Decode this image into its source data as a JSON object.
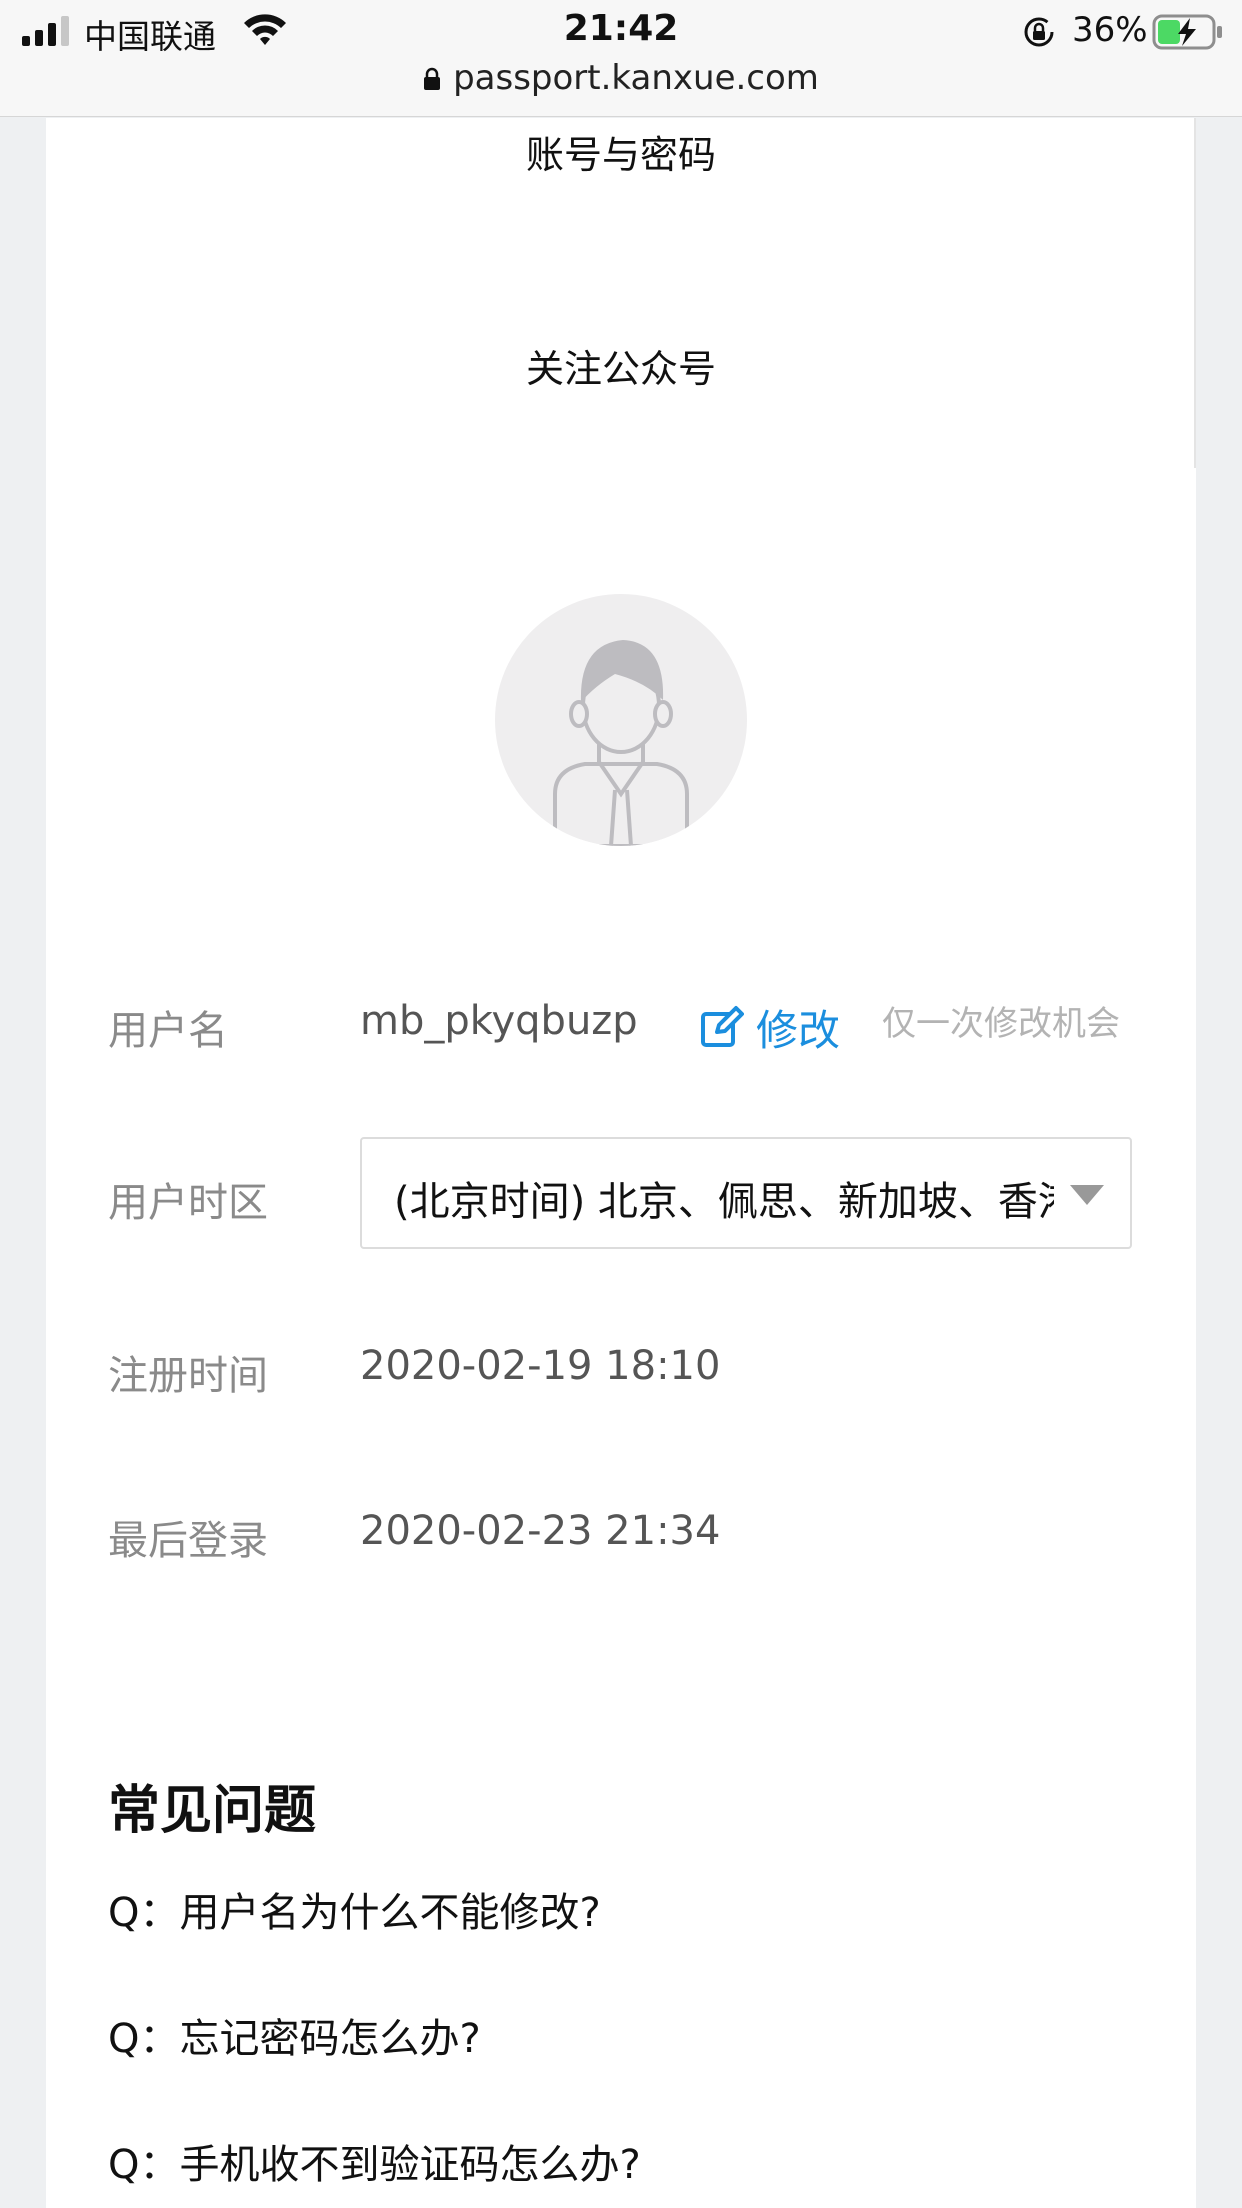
{
  "status_bar": {
    "carrier": "中国联通",
    "time": "21:42",
    "battery": "36%",
    "url": "passport.kanxue.com"
  },
  "menu": {
    "account_password": "账号与密码",
    "follow_wechat": "关注公众号"
  },
  "profile": {
    "username_label": "用户名",
    "username_value": "mb_pkyqbuzp",
    "edit_label": "修改",
    "edit_note": "仅一次修改机会",
    "timezone_label": "用户时区",
    "timezone_value": "(北京时间) 北京、佩思、新加坡、香港",
    "register_label": "注册时间",
    "register_value": "2020-02-19 18:10",
    "last_login_label": "最后登录",
    "last_login_value": "2020-02-23 21:34"
  },
  "faq": {
    "title": "常见问题",
    "questions": [
      "Q：用户名为什么不能修改?",
      "Q：忘记密码怎么办?",
      "Q：手机收不到验证码怎么办?"
    ]
  },
  "colors": {
    "accent": "#1b8ede",
    "battery_charge": "#4cd964"
  }
}
